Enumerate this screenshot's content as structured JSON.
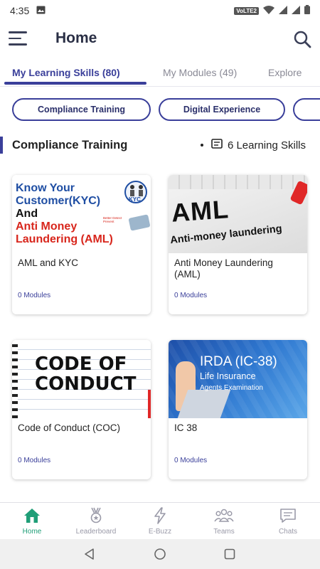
{
  "status": {
    "time": "4:35",
    "network": "VoLTE2"
  },
  "header": {
    "title": "Home"
  },
  "tabs": [
    {
      "label": "My Learning Skills (80)"
    },
    {
      "label": "My Modules (49)"
    },
    {
      "label": "Explore"
    }
  ],
  "chips": [
    {
      "label": "Compliance Training"
    },
    {
      "label": "Digital Experience"
    }
  ],
  "section": {
    "title": "Compliance Training",
    "count": "6 Learning Skills"
  },
  "cards": [
    {
      "title": "AML and KYC",
      "modules": "0 Modules",
      "thumb": {
        "l1": "Know Your",
        "l2": "Customer(KYC)",
        "l3": "And",
        "l4": "Anti Money",
        "l5": "Laundering (AML)",
        "badge": "KYC",
        "tagline": "Better Detect Prevent"
      }
    },
    {
      "title": "Anti Money Laundering (AML)",
      "modules": "0 Modules",
      "thumb": {
        "big": "AML",
        "sub": "Anti-money laundering"
      }
    },
    {
      "title": "Code of Conduct (COC)",
      "modules": "0 Modules",
      "thumb": {
        "l1": "CODE OF",
        "l2": "CONDUCT"
      }
    },
    {
      "title": "IC 38",
      "modules": "0 Modules",
      "thumb": {
        "l1": "IRDA (IC-38)",
        "l2": "Life Insurance",
        "l3": "Agents Examination"
      }
    }
  ],
  "nav": [
    {
      "label": "Home",
      "icon": "home-icon"
    },
    {
      "label": "Leaderboard",
      "icon": "medal-icon"
    },
    {
      "label": "E-Buzz",
      "icon": "lightning-icon"
    },
    {
      "label": "Teams",
      "icon": "teams-icon"
    },
    {
      "label": "Chats",
      "icon": "chat-icon"
    }
  ],
  "colors": {
    "accent": "#3a3f9a",
    "nav_active": "#1f9e77"
  }
}
